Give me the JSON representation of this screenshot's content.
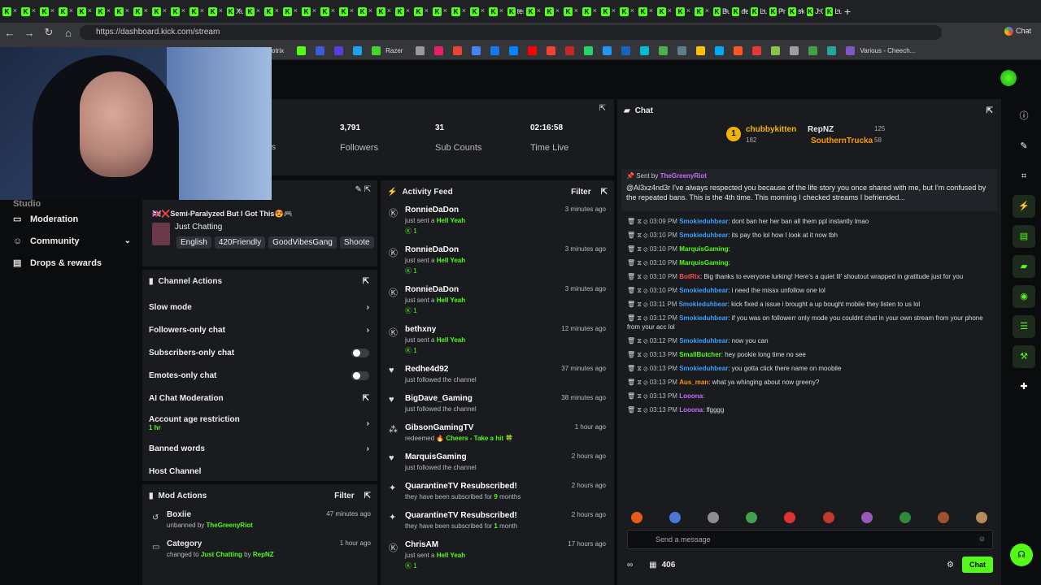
{
  "browser": {
    "tabs": [
      "",
      "",
      "",
      "",
      "",
      "",
      "",
      "",
      "",
      "",
      "",
      "",
      "Xu",
      "",
      "",
      "",
      "",
      "",
      "",
      "",
      "",
      "",
      "",
      "",
      "",
      "",
      "",
      "tei",
      "",
      "",
      "",
      "",
      "",
      "",
      "",
      "",
      "",
      "",
      "Bu",
      "de",
      "Lu",
      "Pri",
      "sk",
      "J.C",
      "Lu"
    ],
    "new_tab": "+",
    "url": "https://dashboard.kick.com/stream",
    "bookmarks": [
      "otrix",
      "Razer",
      "Various - Cheech..."
    ],
    "chat_label": "Chat"
  },
  "stats": {
    "followers_value": "3,791",
    "followers_label": "Followers",
    "subs_value": "31",
    "subs_label": "Sub Counts",
    "time_value": "02:16:58",
    "time_label": "Time Live",
    "left_fragment": "s"
  },
  "sidebar": {
    "items": [
      {
        "label": "Studio"
      },
      {
        "label": "Moderation"
      },
      {
        "label": "Community"
      },
      {
        "label": "Drops & rewards"
      }
    ]
  },
  "stream_info": {
    "title": "🇬🇧❌Semi-Paralyzed But I Got This😍🎮",
    "category": "Just Chatting",
    "tags": [
      "English",
      "420Friendly",
      "GoodVibesGang",
      "Shoote"
    ]
  },
  "channel_actions": {
    "title": "Channel Actions",
    "items": [
      {
        "label": "Slow mode",
        "kind": "arrow"
      },
      {
        "label": "Followers-only chat",
        "kind": "arrow"
      },
      {
        "label": "Subscribers-only chat",
        "kind": "toggle"
      },
      {
        "label": "Emotes-only chat",
        "kind": "toggle"
      },
      {
        "label": "AI Chat Moderation",
        "kind": "link"
      },
      {
        "label": "Account age restriction",
        "sub": "1 hr",
        "kind": "arrow"
      },
      {
        "label": "Banned words",
        "kind": "arrow"
      },
      {
        "label": "Host Channel",
        "kind": "none"
      }
    ]
  },
  "mod_actions": {
    "title": "Mod Actions",
    "filter": "Filter",
    "rows": [
      {
        "name": "Boxiie",
        "desc": "unbanned by",
        "by": "TheGreenyRiot",
        "time": "47 minutes ago"
      },
      {
        "name": "Category",
        "desc": "changed to",
        "by": "Just Chatting",
        "mid": "by",
        "by2": "RepNZ",
        "time": "1 hour ago"
      }
    ]
  },
  "activity": {
    "title": "Activity Feed",
    "filter": "Filter",
    "rows": [
      {
        "name": "RonnieDaDon",
        "desc": "just sent a",
        "gift": "Hell Yeah",
        "count": "1",
        "time": "3 minutes ago"
      },
      {
        "name": "RonnieDaDon",
        "desc": "just sent a",
        "gift": "Hell Yeah",
        "count": "1",
        "time": "3 minutes ago"
      },
      {
        "name": "RonnieDaDon",
        "desc": "just sent a",
        "gift": "Hell Yeah",
        "count": "1",
        "time": "3 minutes ago"
      },
      {
        "name": "bethxny",
        "desc": "just sent a",
        "gift": "Hell Yeah",
        "count": "1",
        "time": "12 minutes ago"
      },
      {
        "name": "Redhe4d92",
        "desc": "just followed the channel",
        "time": "37 minutes ago"
      },
      {
        "name": "BigDave_Gaming",
        "desc": "just followed the channel",
        "time": "38 minutes ago"
      },
      {
        "name": "GibsonGamingTV",
        "desc": "redeemed",
        "gift": "🔥 Cheers - Take a hit 🍀",
        "time": "1 hour ago"
      },
      {
        "name": "MarquisGaming",
        "desc": "just followed the channel",
        "time": "2 hours ago"
      },
      {
        "name": "QuarantineTV Resubscribed!",
        "desc": "they have been subscribed for",
        "gift": "9",
        "desc2": "months",
        "time": "2 hours ago"
      },
      {
        "name": "QuarantineTV Resubscribed!",
        "desc": "they have been subscribed for",
        "gift": "1",
        "desc2": "month",
        "time": "2 hours ago"
      },
      {
        "name": "ChrisAM",
        "desc": "just sent a",
        "gift": "Hell Yeah",
        "count": "1",
        "time": "17 hours ago"
      }
    ]
  },
  "chat": {
    "title": "Chat",
    "leaderboard": [
      {
        "name": "chubbykitten",
        "value": "182"
      },
      {
        "name": "RepNZ",
        "value": "125"
      },
      {
        "name": "SouthernTrucka",
        "value": "58"
      }
    ],
    "pinned": {
      "sent_by": "Sent by",
      "user": "TheGreenyRiot",
      "text": "@Al3xz4nd3r I've always respected you because of the life story you once shared with me, but I'm confused by the repeated bans. This is the 4th time. This morning I checked streams I befriended..."
    },
    "messages": [
      {
        "time": "03:09 PM",
        "user": "Smokieduhbear",
        "color": "#3ca0ff",
        "text": "dont ban her her ban all them ppl instantly lmao"
      },
      {
        "time": "03:10 PM",
        "user": "Smokieduhbear",
        "color": "#3ca0ff",
        "text": "its pay tho lol how I look at it now tbh"
      },
      {
        "time": "03:10 PM",
        "user": "MarquisGaming",
        "color": "#53fc18",
        "text": ""
      },
      {
        "time": "03:10 PM",
        "user": "MarquisGaming",
        "color": "#53fc18",
        "text": ""
      },
      {
        "time": "03:10 PM",
        "user": "BotRix",
        "color": "#ff4d4d",
        "text": "Big thanks to everyone lurking! Here's a quiet lil' shoutout wrapped in gratitude just for you"
      },
      {
        "time": "03:10 PM",
        "user": "Smokieduhbear",
        "color": "#3ca0ff",
        "text": "i need the missx unfollow one lol"
      },
      {
        "time": "03:11 PM",
        "user": "Smokieduhbear",
        "color": "#3ca0ff",
        "text": "kick fixed a issue i brought a up bought mobile they listen to us lol"
      },
      {
        "time": "03:12 PM",
        "user": "Smokieduhbear",
        "color": "#3ca0ff",
        "text": "if you was on followerr only mode you couldnt chat in your own stream from your phone from your acc lol"
      },
      {
        "time": "03:12 PM",
        "user": "Smokieduhbear",
        "color": "#3ca0ff",
        "text": "now you can"
      },
      {
        "time": "03:13 PM",
        "user": "SmallButcher",
        "color": "#53fc18",
        "text": "hey pookie long time no see"
      },
      {
        "time": "03:13 PM",
        "user": "Smokieduhbear",
        "color": "#3ca0ff",
        "text": "you gotta click there name on moobile"
      },
      {
        "time": "03:13 PM",
        "user": "Aus_man",
        "color": "#ff9900",
        "text": "what ya whinging about now greeny?"
      },
      {
        "time": "03:13 PM",
        "user": "Looona",
        "color": "#c86bff",
        "text": ""
      },
      {
        "time": "03:13 PM",
        "user": "Looona",
        "color": "#c86bff",
        "text": "lfgggg"
      }
    ],
    "send_placeholder": "Send a message",
    "viewers": "406",
    "send_button": "Chat"
  }
}
